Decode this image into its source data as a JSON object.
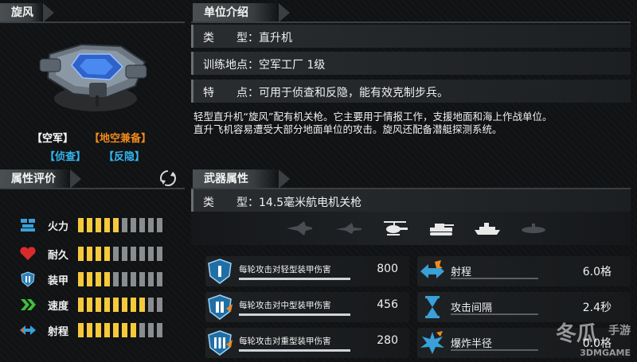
{
  "unit": {
    "name": "旋风",
    "tags_row1": [
      "【空军】",
      "【地空兼备】"
    ],
    "tags_row2": [
      "【侦查】",
      "【反隐】"
    ]
  },
  "attributes": {
    "header": "属性评价",
    "items": [
      {
        "label": "火力",
        "filled": 5,
        "total": 10,
        "icon": "firepower-icon"
      },
      {
        "label": "耐久",
        "filled": 4,
        "total": 10,
        "icon": "heart-icon"
      },
      {
        "label": "装甲",
        "filled": 4,
        "total": 10,
        "icon": "armor-shield-icon"
      },
      {
        "label": "速度",
        "filled": 8,
        "total": 10,
        "icon": "speed-chevron-icon"
      },
      {
        "label": "射程",
        "filled": 7,
        "total": 10,
        "icon": "range-arrow-icon"
      }
    ]
  },
  "intro": {
    "header": "单位介绍",
    "rows": [
      {
        "label": "类　　型：",
        "value": "直升机"
      },
      {
        "label": "训练地点：",
        "value": "空军工厂 1级"
      },
      {
        "label": "特　　点：",
        "value": "可用于侦查和反隐，能有效克制步兵。"
      }
    ],
    "description_1": "轻型直升机“旋风”配有机关枪。它主要用于情报工作，支援地面和海上作战单位。",
    "description_2": "直升飞机容易遭受大部分地面单位的攻击。旋风还配备潜艇探测系统。"
  },
  "weapon": {
    "header": "武器属性",
    "type_label": "类　　型：",
    "type_value": "14.5毫米航电机关枪",
    "targets": [
      "fighter-jet-icon",
      "bomber-jet-icon",
      "helicopter-icon",
      "tank-icon",
      "ship-icon",
      "submarine-icon"
    ],
    "damage": [
      {
        "label": "每轮攻击对轻型装甲伤害",
        "value": "800",
        "icon": "light-armor-icon"
      },
      {
        "label": "每轮攻击对中型装甲伤害",
        "value": "456",
        "icon": "medium-armor-icon"
      },
      {
        "label": "每轮攻击对重型装甲伤害",
        "value": "280",
        "icon": "heavy-armor-icon"
      }
    ],
    "stats": [
      {
        "label": "射程",
        "value": "6.0格",
        "icon": "range-icon"
      },
      {
        "label": "攻击间隔",
        "value": "2.4秒",
        "icon": "hourglass-icon"
      },
      {
        "label": "爆炸半径",
        "value": "0.0格",
        "icon": "explosion-icon"
      }
    ]
  },
  "watermark": {
    "line1": "冬瓜",
    "line2": "手游",
    "line3": "3DMGAME"
  },
  "colors": {
    "filled_bar": "#f6c93c",
    "empty_bar": "#8a8d90",
    "orange": "#f08a1c",
    "blue": "#35b5f0"
  }
}
